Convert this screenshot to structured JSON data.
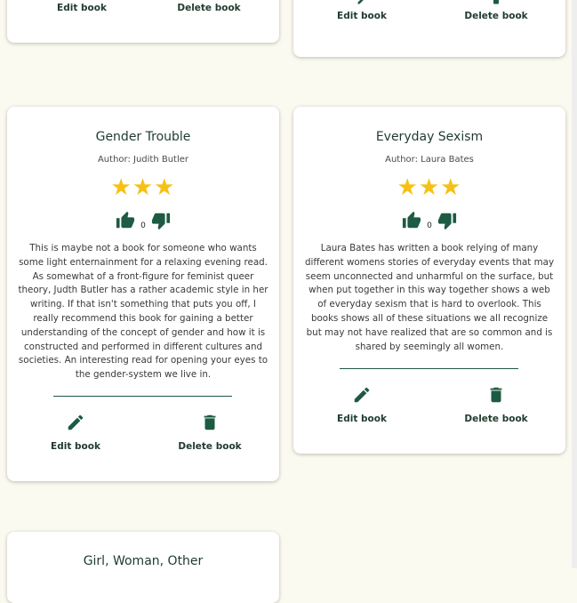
{
  "actions": {
    "edit_label": "Edit book",
    "delete_label": "Delete book"
  },
  "cards": [
    {
      "id": "top-left"
    },
    {
      "id": "top-right"
    },
    {
      "title": "Gender Trouble",
      "author": "Author: Judith Butler",
      "rating": 3,
      "stars": "★★★",
      "votes": "0",
      "description": "This is maybe not a book for someone who wants some light enternainment for a relaxing evening read. As somewhat of a front-figure for feminist queer theory, Judth Butler has a rather academic style in her writing. If that isn't something that puts you off, I really recommend this book for gaining a better understanding of the concept of gender and how it is constructed and performed in different cultures and societies. An interesting read for opening your eyes to the gender-system we live in."
    },
    {
      "title": "Everyday Sexism",
      "author": "Author: Laura Bates",
      "rating": 3,
      "stars": "★★★",
      "votes": "0",
      "description": "Laura Bates has written a book relying of many different womens stories of everyday events that may seem unconnected and unharmful on the surface, but when put together in this way together shows a web of everyday sexism that is hard to overlook. This books shows all of these situations we all recognize but may not have realized that are so common and is shared by seemingly all women."
    },
    {
      "title": "Girl, Woman, Other"
    }
  ],
  "colors": {
    "accent": "#1d5b43",
    "star": "#f6c114",
    "background": "#fbfaf0"
  },
  "icons": {
    "edit": "pencil-icon",
    "delete": "trash-icon",
    "like": "thumbs-up-icon",
    "dislike": "thumbs-down-icon"
  }
}
